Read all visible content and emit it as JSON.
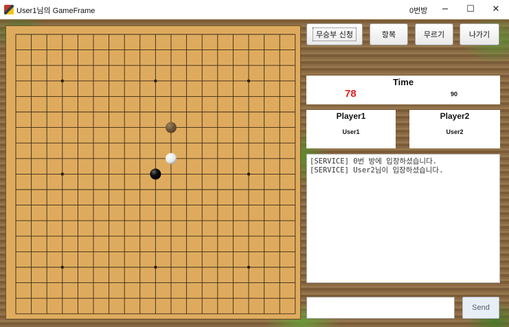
{
  "window": {
    "title": "User1님의 GameFrame",
    "room": "0번방",
    "controls": {
      "minimize": "−",
      "maximize": "☐",
      "close": "✕"
    }
  },
  "toolbar": {
    "draw_request": "무승부 신청",
    "surrender": "항복",
    "undo": "무르기",
    "exit": "나가기"
  },
  "time": {
    "title": "Time",
    "current": "78",
    "limit": "90"
  },
  "players": [
    {
      "label": "Player1",
      "name": "User1"
    },
    {
      "label": "Player2",
      "name": "User2"
    }
  ],
  "chat": {
    "messages": [
      "[SERVICE] 0번 방에 입장하셨습니다.",
      "[SERVICE] User2님이 입장하셨습니다."
    ],
    "input_value": "",
    "send_label": "Send"
  },
  "board": {
    "lines": 19,
    "star_points": [
      [
        3,
        3
      ],
      [
        9,
        3
      ],
      [
        15,
        3
      ],
      [
        3,
        9
      ],
      [
        15,
        9
      ],
      [
        3,
        15
      ],
      [
        9,
        15
      ],
      [
        15,
        15
      ]
    ],
    "stones": [
      {
        "col": 10,
        "row": 6,
        "color": "ghost"
      },
      {
        "col": 10,
        "row": 8,
        "color": "white"
      },
      {
        "col": 9,
        "row": 9,
        "color": "black"
      }
    ]
  },
  "colors": {
    "board": "#deab5e",
    "time_accent": "#e02020"
  }
}
